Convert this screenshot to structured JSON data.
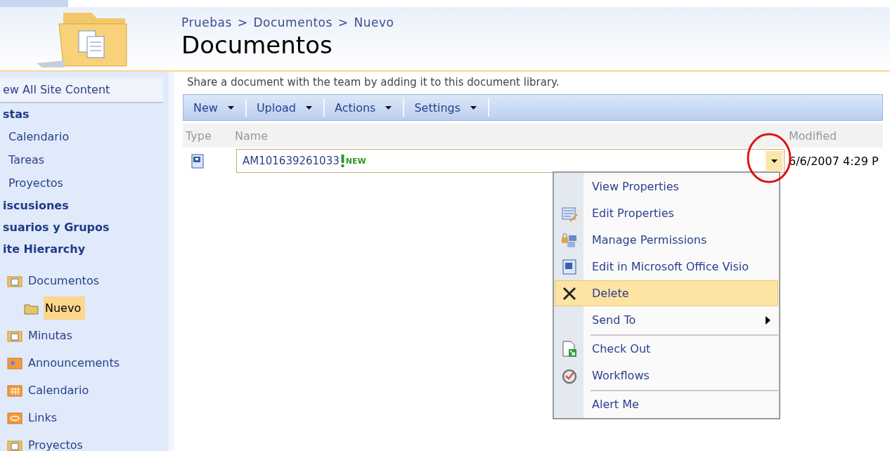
{
  "breadcrumb": {
    "separator": ">",
    "items": [
      {
        "label": "Pruebas"
      },
      {
        "label": "Documentos"
      },
      {
        "label": "Nuevo"
      }
    ]
  },
  "page_title": "Documentos",
  "sidebar": {
    "view_all": "ew All Site Content",
    "sections": [
      {
        "heading": "stas",
        "items": [
          {
            "label": "Calendario"
          },
          {
            "label": "Tareas"
          },
          {
            "label": "Proyectos"
          }
        ]
      },
      {
        "heading": "iscusiones"
      },
      {
        "heading": "suarios y Grupos"
      },
      {
        "heading": "ite Hierarchy"
      }
    ],
    "tree": [
      {
        "label": "Documentos",
        "kind": "library",
        "selected": false,
        "children": [
          {
            "label": "Nuevo",
            "kind": "folder",
            "selected": true
          }
        ]
      },
      {
        "label": "Minutas",
        "kind": "library",
        "selected": false
      },
      {
        "label": "Announcements",
        "kind": "announcements",
        "selected": false
      },
      {
        "label": "Calendario",
        "kind": "calendar",
        "selected": false
      },
      {
        "label": "Links",
        "kind": "links",
        "selected": false
      },
      {
        "label": "Proyectos",
        "kind": "library",
        "selected": false
      }
    ]
  },
  "description": "Share a document with the team by adding it to this document library.",
  "toolbar": [
    {
      "label": "New"
    },
    {
      "label": "Upload"
    },
    {
      "label": "Actions"
    },
    {
      "label": "Settings"
    }
  ],
  "columns": [
    "Type",
    "Name",
    "Modified"
  ],
  "rows": [
    {
      "name": "AM101639261033",
      "badge": "NEW",
      "modified": "6/6/2007 4:29 P",
      "menu_open": true
    }
  ],
  "context_menu": [
    {
      "label": "View Properties",
      "kind": "plain",
      "selected": false,
      "submenu": false,
      "separator_before": false
    },
    {
      "label": "Edit Properties",
      "kind": "edit",
      "selected": false,
      "submenu": false,
      "separator_before": false
    },
    {
      "label": "Manage Permissions",
      "kind": "permissions",
      "selected": false,
      "submenu": false,
      "separator_before": false
    },
    {
      "label": "Edit in Microsoft Office Visio",
      "kind": "visio",
      "selected": false,
      "submenu": false,
      "separator_before": false
    },
    {
      "label": "Delete",
      "kind": "delete",
      "selected": true,
      "submenu": false,
      "separator_before": false
    },
    {
      "label": "Send To",
      "kind": "plain",
      "selected": false,
      "submenu": true,
      "separator_before": false
    },
    {
      "label": "Check Out",
      "kind": "checkout",
      "selected": false,
      "submenu": false,
      "separator_before": true
    },
    {
      "label": "Workflows",
      "kind": "workflow",
      "selected": false,
      "submenu": false,
      "separator_before": false
    },
    {
      "label": "Alert Me",
      "kind": "plain",
      "selected": false,
      "submenu": false,
      "separator_before": true
    }
  ]
}
